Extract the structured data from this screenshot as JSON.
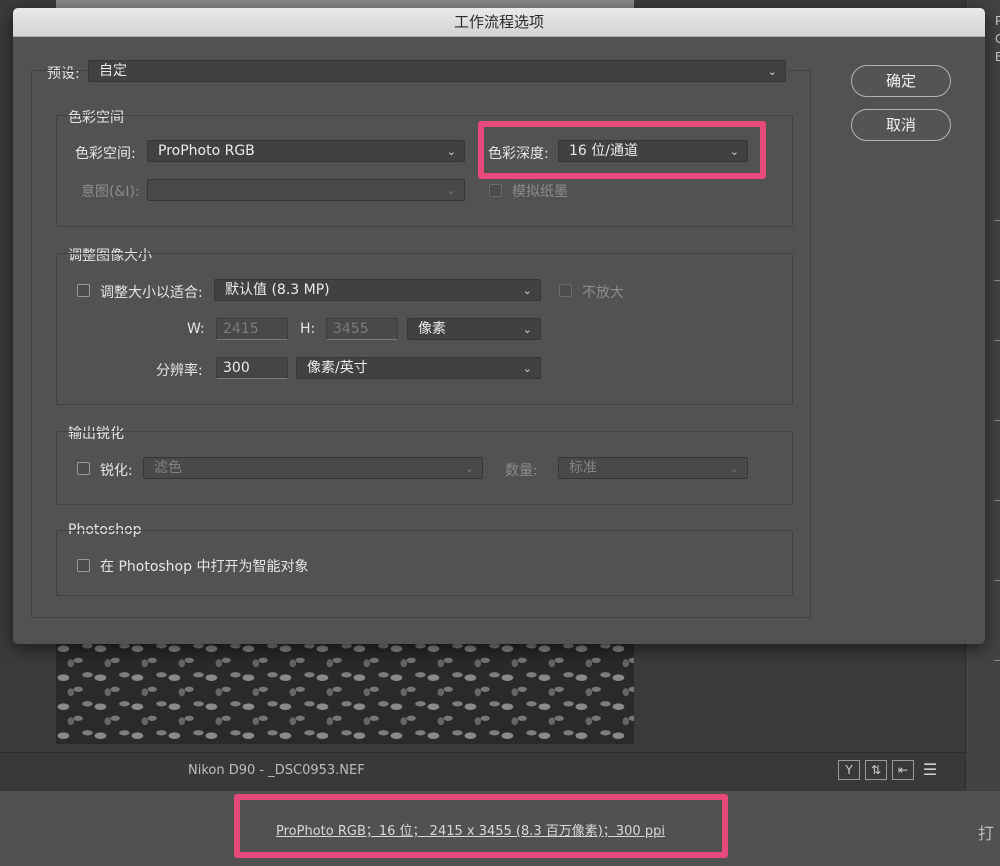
{
  "dialog": {
    "title": "工作流程选项",
    "preset": {
      "label": "预设:",
      "value": "自定"
    },
    "buttons": {
      "ok": "确定",
      "cancel": "取消"
    },
    "color_space_section": {
      "title": "色彩空间",
      "space_label": "色彩空间:",
      "space_value": "ProPhoto RGB",
      "intent_label": "意图(&I):",
      "intent_value": "",
      "depth_label": "色彩深度:",
      "depth_value": "16 位/通道",
      "simulate_label": "模拟纸墨"
    },
    "resize_section": {
      "title": "调整图像大小",
      "fit_label": "调整大小以适合:",
      "fit_value": "默认值 (8.3 MP)",
      "no_enlarge_label": "不放大",
      "w_label": "W:",
      "w_value": "2415",
      "h_label": "H:",
      "h_value": "3455",
      "unit_value": "像素",
      "resolution_label": "分辨率:",
      "resolution_value": "300",
      "res_unit_value": "像素/英寸"
    },
    "sharpen_section": {
      "title": "输出锐化",
      "sharpen_label": "锐化:",
      "sharpen_value": "滤色",
      "amount_label": "数量:",
      "amount_value": "标准"
    },
    "photoshop_section": {
      "title": "Photoshop",
      "smart_object_label": "在 Photoshop 中打开为智能对象"
    }
  },
  "app": {
    "filename": "Nikon D90 -  _DSC0953.NEF",
    "status_link": "ProPhoto RGB；16 位； 2415 x 3455 (8.3 百万像素)；300 ppi",
    "right_panel_letters": [
      "P",
      "C",
      "E"
    ],
    "bottom_right_partial": "打"
  },
  "colors": {
    "highlight": "#e8497b",
    "dialog_bg": "#535253",
    "title_bar": "#dedede"
  }
}
